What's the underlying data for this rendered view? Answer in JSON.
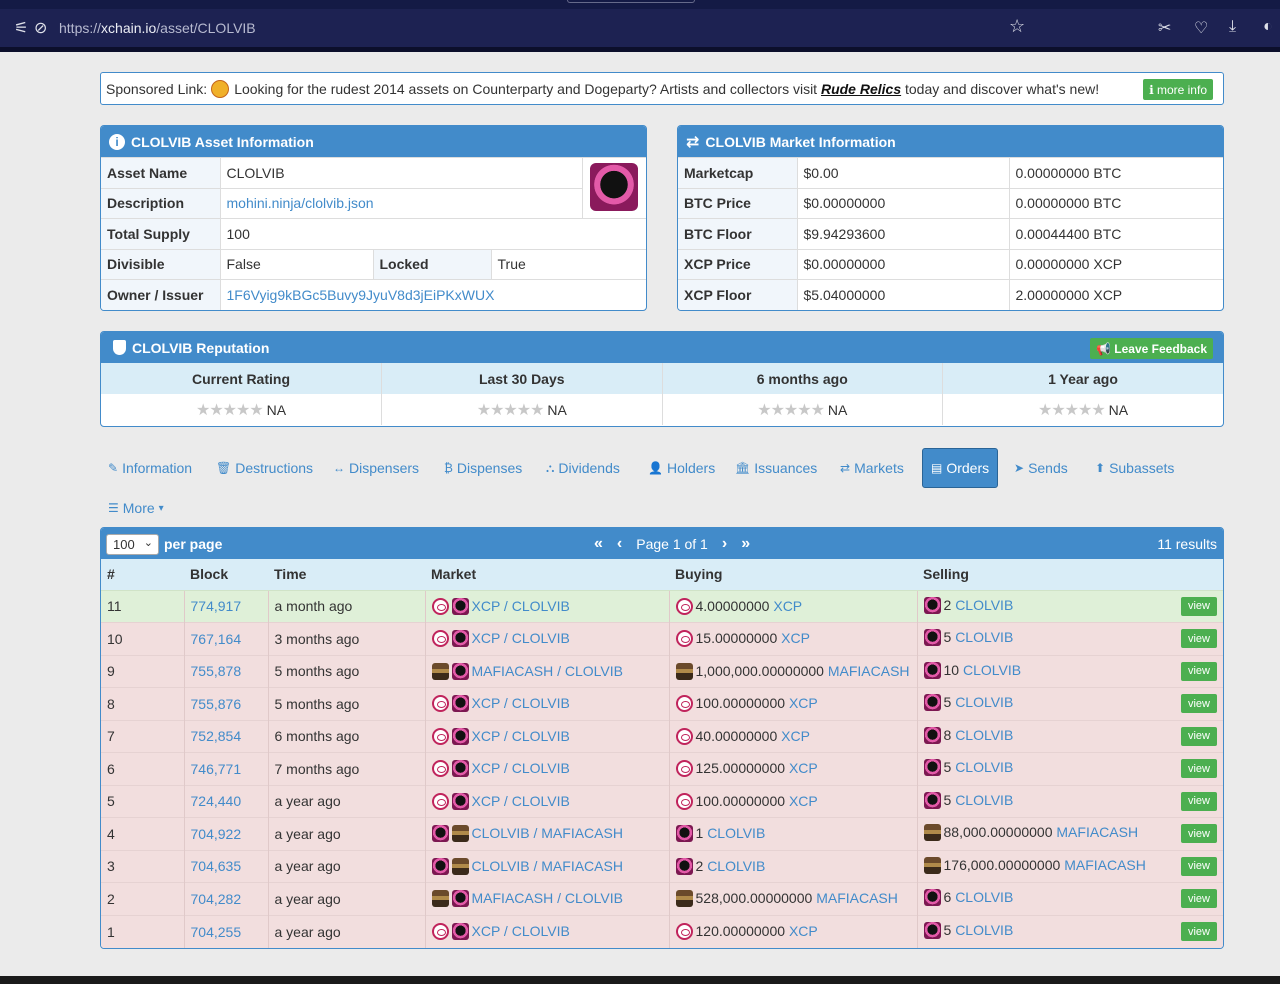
{
  "browser": {
    "url_prefix": "https://",
    "url_host": "xchain.io",
    "url_path": "/asset/CLOLVIB"
  },
  "sponsored": {
    "label": "Sponsored Link:",
    "text_before": "Looking for the rudest 2014 assets on Counterparty and Dogeparty? Artists and collectors visit",
    "link_text": "Rude Relics",
    "text_after": "today and discover what's new!",
    "button": "more info"
  },
  "asset_info": {
    "title": "CLOLVIB Asset Information",
    "asset_name_label": "Asset Name",
    "asset_name": "CLOLVIB",
    "description_label": "Description",
    "description": "mohini.ninja/clolvib.json",
    "total_supply_label": "Total Supply",
    "total_supply": "100",
    "divisible_label": "Divisible",
    "divisible": "False",
    "locked_label": "Locked",
    "locked": "True",
    "owner_label": "Owner / Issuer",
    "owner": "1F6Vyig9kBGc5Buvy9JyuV8d3jEiPKxWUX"
  },
  "market_info": {
    "title": "CLOLVIB Market Information",
    "rows": [
      {
        "label": "Marketcap",
        "usd": "$0.00",
        "alt": "0.00000000 BTC"
      },
      {
        "label": "BTC Price",
        "usd": "$0.00000000",
        "alt": "0.00000000 BTC"
      },
      {
        "label": "BTC Floor",
        "usd": "$9.94293600",
        "alt": "0.00044400 BTC"
      },
      {
        "label": "XCP Price",
        "usd": "$0.00000000",
        "alt": "0.00000000 XCP"
      },
      {
        "label": "XCP Floor",
        "usd": "$5.04000000",
        "alt": "2.00000000 XCP"
      }
    ]
  },
  "reputation": {
    "title": "CLOLVIB Reputation",
    "button": "Leave Feedback",
    "columns": [
      "Current Rating",
      "Last 30 Days",
      "6 months ago",
      "1 Year ago"
    ],
    "values": [
      "NA",
      "NA",
      "NA",
      "NA"
    ]
  },
  "tabs": [
    "Information",
    "Destructions",
    "Dispensers",
    "Dispenses",
    "Dividends",
    "Holders",
    "Issuances",
    "Markets",
    "Orders",
    "Sends",
    "Subassets",
    "More"
  ],
  "orders": {
    "per_page_value": "100",
    "per_page_label": "per page",
    "page_label": "Page 1 of 1",
    "results": "11 results",
    "headers": [
      "#",
      "Block",
      "Time",
      "Market",
      "Buying",
      "Selling"
    ],
    "view_label": "view",
    "rows": [
      {
        "n": "11",
        "block": "774,917",
        "time": "a month ago",
        "market": "XCP / CLOLVIB",
        "m1": "xcp",
        "m2": "clv",
        "buy_amt": "4.00000000",
        "buy_asset": "XCP",
        "buy_icon": "xcp",
        "sell_amt": "2",
        "sell_asset": "CLOLVIB",
        "sell_icon": "clv",
        "status": "green"
      },
      {
        "n": "10",
        "block": "767,164",
        "time": "3 months ago",
        "market": "XCP / CLOLVIB",
        "m1": "xcp",
        "m2": "clv",
        "buy_amt": "15.00000000",
        "buy_asset": "XCP",
        "buy_icon": "xcp",
        "sell_amt": "5",
        "sell_asset": "CLOLVIB",
        "sell_icon": "clv",
        "status": "red"
      },
      {
        "n": "9",
        "block": "755,878",
        "time": "5 months ago",
        "market": "MAFIACASH / CLOLVIB",
        "m1": "maf",
        "m2": "clv",
        "buy_amt": "1,000,000.00000000",
        "buy_asset": "MAFIACASH",
        "buy_icon": "maf",
        "sell_amt": "10",
        "sell_asset": "CLOLVIB",
        "sell_icon": "clv",
        "status": "red"
      },
      {
        "n": "8",
        "block": "755,876",
        "time": "5 months ago",
        "market": "XCP / CLOLVIB",
        "m1": "xcp",
        "m2": "clv",
        "buy_amt": "100.00000000",
        "buy_asset": "XCP",
        "buy_icon": "xcp",
        "sell_amt": "5",
        "sell_asset": "CLOLVIB",
        "sell_icon": "clv",
        "status": "red"
      },
      {
        "n": "7",
        "block": "752,854",
        "time": "6 months ago",
        "market": "XCP / CLOLVIB",
        "m1": "xcp",
        "m2": "clv",
        "buy_amt": "40.00000000",
        "buy_asset": "XCP",
        "buy_icon": "xcp",
        "sell_amt": "8",
        "sell_asset": "CLOLVIB",
        "sell_icon": "clv",
        "status": "red"
      },
      {
        "n": "6",
        "block": "746,771",
        "time": "7 months ago",
        "market": "XCP / CLOLVIB",
        "m1": "xcp",
        "m2": "clv",
        "buy_amt": "125.00000000",
        "buy_asset": "XCP",
        "buy_icon": "xcp",
        "sell_amt": "5",
        "sell_asset": "CLOLVIB",
        "sell_icon": "clv",
        "status": "red"
      },
      {
        "n": "5",
        "block": "724,440",
        "time": "a year ago",
        "market": "XCP / CLOLVIB",
        "m1": "xcp",
        "m2": "clv",
        "buy_amt": "100.00000000",
        "buy_asset": "XCP",
        "buy_icon": "xcp",
        "sell_amt": "5",
        "sell_asset": "CLOLVIB",
        "sell_icon": "clv",
        "status": "red"
      },
      {
        "n": "4",
        "block": "704,922",
        "time": "a year ago",
        "market": "CLOLVIB / MAFIACASH",
        "m1": "clv",
        "m2": "maf",
        "buy_amt": "1",
        "buy_asset": "CLOLVIB",
        "buy_icon": "clv",
        "sell_amt": "88,000.00000000",
        "sell_asset": "MAFIACASH",
        "sell_icon": "maf",
        "status": "red"
      },
      {
        "n": "3",
        "block": "704,635",
        "time": "a year ago",
        "market": "CLOLVIB / MAFIACASH",
        "m1": "clv",
        "m2": "maf",
        "buy_amt": "2",
        "buy_asset": "CLOLVIB",
        "buy_icon": "clv",
        "sell_amt": "176,000.00000000",
        "sell_asset": "MAFIACASH",
        "sell_icon": "maf",
        "status": "red"
      },
      {
        "n": "2",
        "block": "704,282",
        "time": "a year ago",
        "market": "MAFIACASH / CLOLVIB",
        "m1": "maf",
        "m2": "clv",
        "buy_amt": "528,000.00000000",
        "buy_asset": "MAFIACASH",
        "buy_icon": "maf",
        "sell_amt": "6",
        "sell_asset": "CLOLVIB",
        "sell_icon": "clv",
        "status": "red"
      },
      {
        "n": "1",
        "block": "704,255",
        "time": "a year ago",
        "market": "XCP / CLOLVIB",
        "m1": "xcp",
        "m2": "clv",
        "buy_amt": "120.00000000",
        "buy_asset": "XCP",
        "buy_icon": "xcp",
        "sell_amt": "5",
        "sell_asset": "CLOLVIB",
        "sell_icon": "clv",
        "status": "red"
      }
    ]
  },
  "colors": {
    "primary": "#428bca",
    "green_row": "#dff0d8",
    "red_row": "#f2dede",
    "button_green": "#4caf50"
  }
}
